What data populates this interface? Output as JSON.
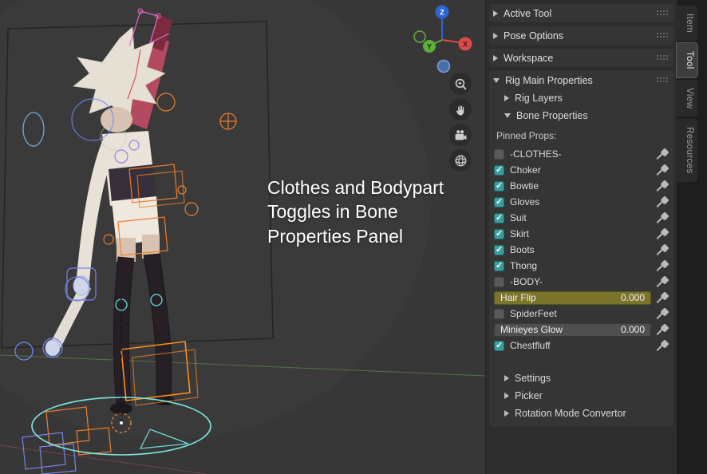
{
  "viewport": {
    "caption": "Clothes and Bodypart Toggles in Bone Properties Panel",
    "gizmo": {
      "x_label": "X",
      "y_label": "Y",
      "z_label": "Z"
    },
    "tool_icons": [
      "zoom-icon",
      "pan-hand-icon",
      "camera-icon",
      "perspective-grid-icon"
    ]
  },
  "sidebar": {
    "panels": {
      "active_tool": "Active Tool",
      "pose_options": "Pose Options",
      "workspace": "Workspace",
      "rig_main": "Rig Main Properties",
      "rig_layers": "Rig Layers",
      "bone_properties": "Bone Properties",
      "settings": "Settings",
      "picker": "Picker",
      "rotation_mode": "Rotation Mode Convertor"
    },
    "pinned_props_label": "Pinned Props:",
    "rows": [
      {
        "type": "checkbox",
        "label": "-CLOTHES-",
        "checked": false
      },
      {
        "type": "checkbox",
        "label": "Choker",
        "checked": true
      },
      {
        "type": "checkbox",
        "label": "Bowtie",
        "checked": true
      },
      {
        "type": "checkbox",
        "label": "Gloves",
        "checked": true
      },
      {
        "type": "checkbox",
        "label": "Suit",
        "checked": true
      },
      {
        "type": "checkbox",
        "label": "Skirt",
        "checked": true
      },
      {
        "type": "checkbox",
        "label": "Boots",
        "checked": true
      },
      {
        "type": "checkbox",
        "label": "Thong",
        "checked": true
      },
      {
        "type": "checkbox",
        "label": "-BODY-",
        "checked": false
      },
      {
        "type": "slider",
        "label": "Hair Flip",
        "value": "0.000",
        "color": "#7b752c"
      },
      {
        "type": "checkbox",
        "label": "SpiderFeet",
        "checked": false
      },
      {
        "type": "slider",
        "label": "Minieyes Glow",
        "value": "0.000",
        "color": "#4f4f4f"
      },
      {
        "type": "checkbox",
        "label": "Chestfluff",
        "checked": true
      }
    ]
  },
  "tabs": {
    "items": [
      "Item",
      "Tool",
      "View",
      "Resources"
    ],
    "active": "Tool"
  },
  "colors": {
    "checkbox_checked": "#3a9e9e",
    "axis_x": "#d94b4b",
    "axis_y": "#5fae3a",
    "axis_z": "#2f63d4"
  }
}
